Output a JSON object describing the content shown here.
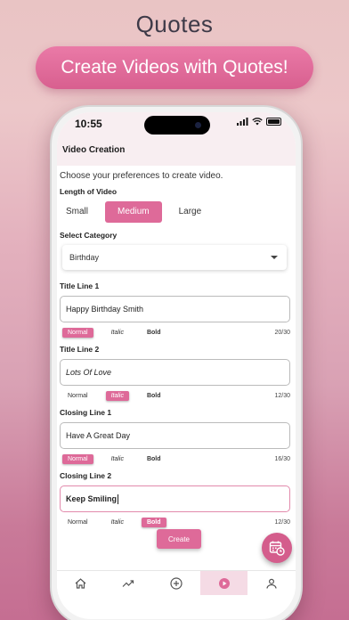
{
  "headline": "Quotes",
  "promo": "Create Videos with Quotes!",
  "status": {
    "time": "10:55"
  },
  "nav": {
    "title": "Video Creation"
  },
  "intro": "Choose your preferences to create video.",
  "length": {
    "label": "Length of Video",
    "options": [
      "Small",
      "Medium",
      "Large"
    ],
    "selected": "Medium"
  },
  "category": {
    "label": "Select Category",
    "value": "Birthday"
  },
  "format_labels": [
    "Normal",
    "Italic",
    "Bold"
  ],
  "lines": [
    {
      "label": "Title Line 1",
      "value": "Happy Birthday Smith",
      "style": "Normal",
      "count": "20/30"
    },
    {
      "label": "Title Line 2",
      "value": "Lots Of Love",
      "style": "Italic",
      "count": "12/30"
    },
    {
      "label": "Closing Line 1",
      "value": "Have A Great Day",
      "style": "Normal",
      "count": "16/30"
    },
    {
      "label": "Closing Line 2",
      "value": "Keep Smiling",
      "style": "Bold",
      "count": "12/30"
    }
  ],
  "create_button": "Create",
  "tabs": [
    "home-icon",
    "trending-icon",
    "add-circle-icon",
    "play-icon",
    "profile-icon"
  ],
  "active_tab": "play-icon",
  "colors": {
    "accent": "#de6a99",
    "fab": "#d45d8c"
  }
}
